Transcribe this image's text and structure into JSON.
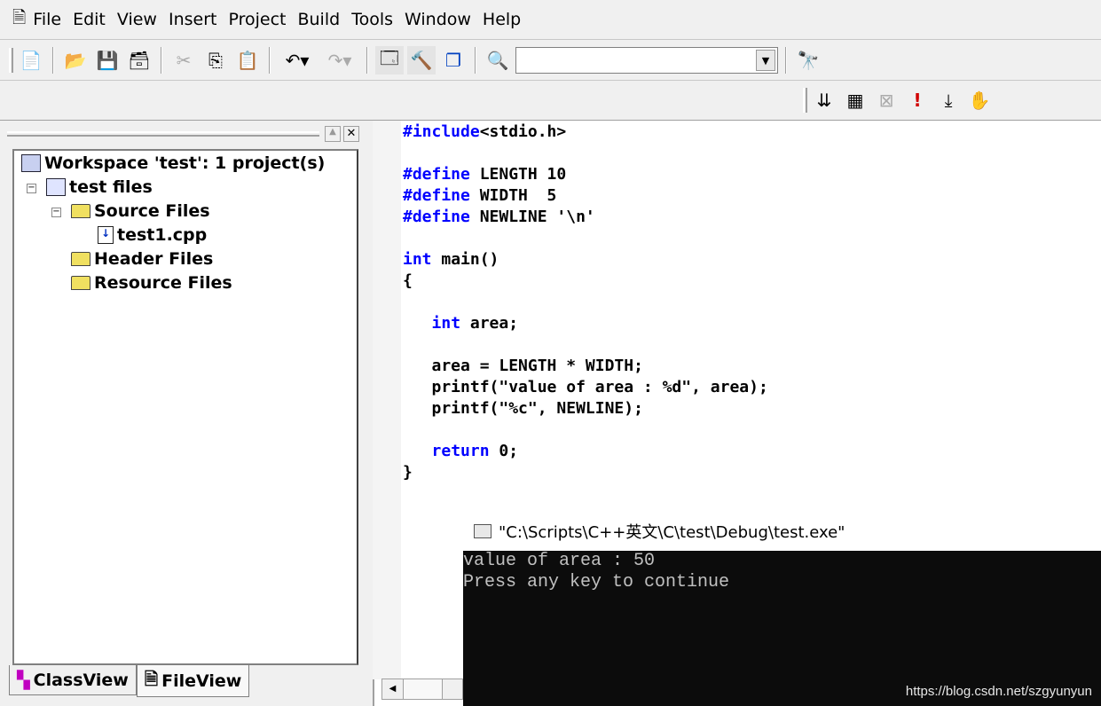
{
  "menu": [
    "File",
    "Edit",
    "View",
    "Insert",
    "Project",
    "Build",
    "Tools",
    "Window",
    "Help"
  ],
  "toolbar": {
    "combo_value": ""
  },
  "tree": {
    "workspace": "Workspace 'test': 1 project(s)",
    "project": "test files",
    "source": "Source Files",
    "file": "test1.cpp",
    "header": "Header Files",
    "resource": "Resource Files"
  },
  "tabs": [
    "ClassView",
    "FileView"
  ],
  "code": [
    [
      [
        "kw",
        "#include"
      ],
      [
        "",
        "<stdio.h>"
      ]
    ],
    [],
    [
      [
        "kw",
        "#define"
      ],
      [
        "",
        " LENGTH 10"
      ]
    ],
    [
      [
        "kw",
        "#define"
      ],
      [
        "",
        " WIDTH  5"
      ]
    ],
    [
      [
        "kw",
        "#define"
      ],
      [
        "",
        " NEWLINE '\\n'"
      ]
    ],
    [],
    [
      [
        "kw",
        "int"
      ],
      [
        "",
        " main()"
      ]
    ],
    [
      [
        "",
        "{"
      ]
    ],
    [],
    [
      [
        "",
        "   "
      ],
      [
        "kw",
        "int"
      ],
      [
        "",
        " area;"
      ]
    ],
    [],
    [
      [
        "",
        "   area = LENGTH * WIDTH;"
      ]
    ],
    [
      [
        "",
        "   printf(\"value of area : %d\", area);"
      ]
    ],
    [
      [
        "",
        "   printf(\"%c\", NEWLINE);"
      ]
    ],
    [],
    [
      [
        "",
        "   "
      ],
      [
        "kw",
        "return"
      ],
      [
        "",
        " 0;"
      ]
    ],
    [
      [
        "",
        "}"
      ]
    ]
  ],
  "console": {
    "title": "\"C:\\Scripts\\C++英文\\C\\test\\Debug\\test.exe\"",
    "lines": [
      "value of area : 50",
      "Press any key to continue"
    ]
  },
  "watermark": "https://blog.csdn.net/szgyunyun"
}
